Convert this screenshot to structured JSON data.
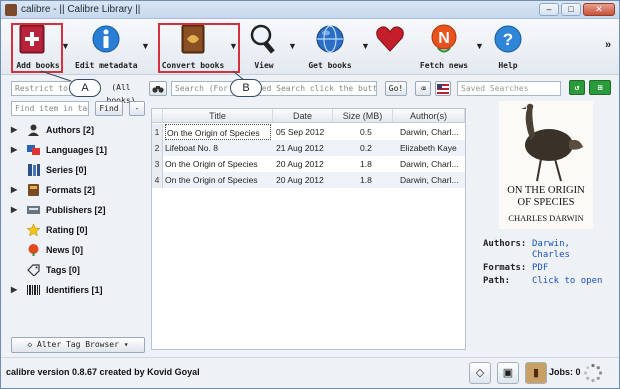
{
  "window": {
    "title": "calibre - || Calibre Library ||",
    "min_symbol": "–",
    "max_symbol": "□",
    "close_symbol": "✕"
  },
  "toolbar": {
    "add_books": "Add books",
    "edit_metadata": "Edit metadata",
    "convert_books": "Convert books",
    "view": "View",
    "get_books": "Get books",
    "fetch_news": "Fetch news",
    "help": "Help",
    "overflow": "»"
  },
  "callouts": {
    "a": "A",
    "b": "B"
  },
  "search": {
    "restrict_placeholder": "Restrict to",
    "all_books": "(All books)",
    "search_placeholder": "Search (For Advanced Search click the button to the left)",
    "go": "Go!",
    "saved_searches": "Saved Searches"
  },
  "tag_browser": {
    "find_placeholder": "Find item in tag browser",
    "find_button": "Find",
    "collapse_button": "-",
    "categories": [
      {
        "label": "Authors [2]",
        "icon": "user-icon",
        "expandable": true
      },
      {
        "label": "Languages [1]",
        "icon": "languages-icon",
        "expandable": true
      },
      {
        "label": "Series [0]",
        "icon": "series-icon",
        "expandable": false
      },
      {
        "label": "Formats [2]",
        "icon": "book-icon",
        "expandable": true
      },
      {
        "label": "Publishers [2]",
        "icon": "publisher-icon",
        "expandable": true
      },
      {
        "label": "Rating [0]",
        "icon": "star-icon",
        "expandable": false
      },
      {
        "label": "News [0]",
        "icon": "news-icon",
        "expandable": false
      },
      {
        "label": "Tags [0]",
        "icon": "tag-icon",
        "expandable": false
      },
      {
        "label": "Identifiers [1]",
        "icon": "barcode-icon",
        "expandable": true
      }
    ],
    "alter_button": "Alter Tag Browser"
  },
  "table": {
    "columns": [
      "Title",
      "Date",
      "Size (MB)",
      "Author(s)"
    ],
    "rows": [
      {
        "n": "1",
        "title": "On the Origin of Species",
        "date": "05 Sep 2012",
        "size": "0.5",
        "author": "Darwin, Charl..."
      },
      {
        "n": "2",
        "title": "Lifeboat No. 8",
        "date": "21 Aug 2012",
        "size": "0.2",
        "author": "Elizabeth Kaye"
      },
      {
        "n": "3",
        "title": "On the Origin of Species",
        "date": "20 Aug 2012",
        "size": "1.8",
        "author": "Darwin, Charl..."
      },
      {
        "n": "4",
        "title": "On the Origin of Species",
        "date": "20 Aug 2012",
        "size": "1.8",
        "author": "Darwin, Charl..."
      }
    ],
    "selected_row": 0
  },
  "details": {
    "cover_title_1": "ON THE ORIGIN",
    "cover_title_2": "OF SPECIES",
    "cover_author": "CHARLES DARWIN",
    "authors_label": "Authors:",
    "authors_value_1": "Darwin,",
    "authors_value_2": "Charles",
    "formats_label": "Formats:",
    "formats_value": "PDF",
    "path_label": "Path:",
    "path_value": "Click to open"
  },
  "status": {
    "text": "calibre version 0.8.67 created by Kovid Goyal",
    "jobs": "Jobs: 0"
  },
  "colors": {
    "annotation_red": "#d4303e",
    "link_blue": "#1a4fc4",
    "row_alt": "#eef3f9"
  }
}
